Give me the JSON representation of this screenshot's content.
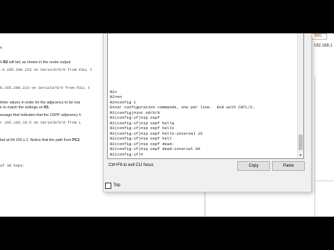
{
  "document": {
    "lines": [
      {
        "text": "s",
        "mono": false
      },
      {
        "pre": "h ",
        "bold": "R2",
        "post": " will fail, as shown in the router output",
        "mono": false
      },
      {
        "text": ".6.165.200.223 on Serial0/0/0 from FULL t",
        "mono": true
      },
      {
        "text": "6.165.200.223 on Serial0/0/0 from FULL t",
        "mono": true
      },
      {
        "text": "timer values in order for the adjacency to be mai",
        "mono": false
      },
      {
        "pre": "e to match the settings on ",
        "bold": "R1",
        "post": "",
        "mono": false
      },
      {
        "text": "essage that indicates that the OSPF adjacency h",
        "mono": false
      },
      {
        "text": "r 192.165.10.5 on Serial0/0/0 from L",
        "mono": true
      },
      {
        "pre": "ted at 64.100.1.2. Notice that the path from ",
        "bold": "PC1",
        "post": "",
        "mono": false
      },
      {
        "text": "of 30 hops:",
        "mono": true
      }
    ]
  },
  "background_right": {
    "badge": "B0G",
    "ip": "192.168.1"
  },
  "terminal": {
    "lines": [
      "R2>",
      "R2>en",
      "R2#config t",
      "Enter configuration commands, one per line.  End with CNTL/Z.",
      "R2(config)#int s0/0/0",
      "R2(config-if)#ip ospf",
      "R2(config-if)#ip ospf hellq",
      "R2(config-if)#ip ospf hello",
      "R2(config-if)#ip ospf hello-interval 15",
      "R2(config-if)#ip ospf hell",
      "R2(config-if)#ip ospf dead-",
      "R2(config-if)#ip ospf dead-interval 60",
      "R2(config-if)#"
    ]
  },
  "footer": {
    "hint": "Ctrl+F6 to exit CLI focus",
    "copy_label": "Copy",
    "paste_label": "Paste",
    "top_label": "Top",
    "top_checked": false
  }
}
